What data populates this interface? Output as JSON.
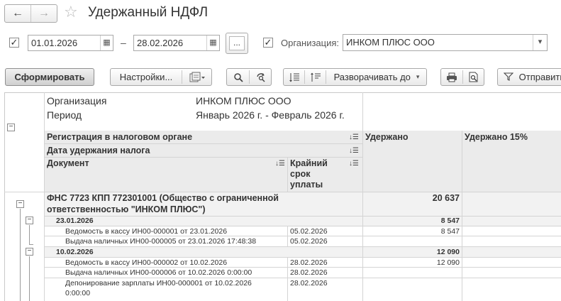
{
  "window": {
    "title": "Удержанный НДФЛ"
  },
  "icons": {
    "back": "←",
    "forward": "→",
    "star": "☆",
    "calendar": "▦",
    "check": "✓",
    "dropdown": "▾",
    "search": "🔍",
    "refresh": "↻",
    "print": "⎙",
    "sort": "↓☰"
  },
  "params": {
    "date_from": "01.01.2026",
    "date_sep": "–",
    "date_to": "28.02.2026",
    "period_button": "...",
    "org_label": "Организация:",
    "org_value": "ИНКОМ ПЛЮС ООО"
  },
  "toolbar": {
    "generate": "Сформировать",
    "settings": "Настройки...",
    "expand_to": "Разворачивать до",
    "send": "Отправить"
  },
  "report": {
    "meta": [
      {
        "label": "Организация",
        "value": "ИНКОМ ПЛЮС ООО"
      },
      {
        "label": "Период",
        "value": "Январь 2026 г. - Февраль 2026 г."
      }
    ],
    "headers": {
      "registration": "Регистрация в налоговом органе",
      "date": "Дата удержания налога",
      "document": "Документ",
      "deadline_1": "Крайний",
      "deadline_2": "срок",
      "deadline_3": "уплаты",
      "withheld": "Удержано",
      "withheld15": "Удержано 15%"
    },
    "group": {
      "line1": "ФНС 7723 КПП 772301001 (Общество с ограниченной",
      "line2": "ответственностью \"ИНКОМ ПЛЮС\")",
      "total": "20 637"
    },
    "dates": [
      {
        "date": "23.01.2026",
        "total": "8 547",
        "docs": [
          {
            "name": "Ведомость в кассу ИН00-000001 от 23.01.2026",
            "deadline": "05.02.2026",
            "amount": "8 547"
          },
          {
            "name": "Выдача наличных ИН00-000005 от 23.01.2026 17:48:38",
            "deadline": "05.02.2026",
            "amount": ""
          }
        ]
      },
      {
        "date": "10.02.2026",
        "total": "12 090",
        "docs": [
          {
            "name": "Ведомость в кассу ИН00-000002 от 10.02.2026",
            "deadline": "28.02.2026",
            "amount": "12 090"
          },
          {
            "name": "Выдача наличных ИН00-000006 от 10.02.2026 0:00:00",
            "deadline": "28.02.2026",
            "amount": ""
          },
          {
            "name1": "Депонирование зарплаты ИН00-000001 от 10.02.2026",
            "name2": "0:00:00",
            "deadline": "28.02.2026",
            "amount": ""
          }
        ]
      }
    ]
  }
}
